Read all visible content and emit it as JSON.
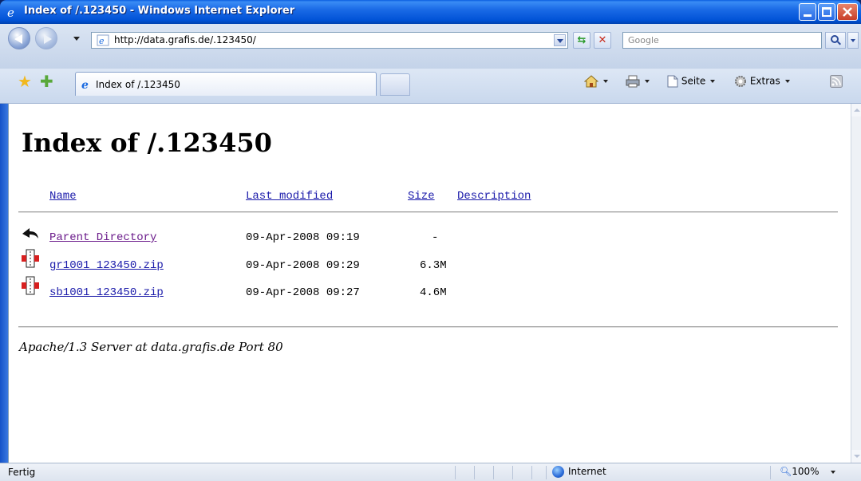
{
  "window": {
    "title": "Index of /.123450 - Windows Internet Explorer"
  },
  "addressbar": {
    "url": "http://data.grafis.de/.123450/",
    "search_placeholder": "Google"
  },
  "tabs": [
    {
      "label": "Index of /.123450"
    }
  ],
  "commandbar": {
    "page_label": "Seite",
    "tools_label": "Extras"
  },
  "page": {
    "title": "Index of /.123450",
    "columns": {
      "name": "Name",
      "modified": "Last modified",
      "size": "Size",
      "description": "Description"
    },
    "rows": [
      {
        "icon": "parent-directory-icon",
        "name": "Parent Directory",
        "modified": "09-Apr-2008 09:19",
        "size": "-",
        "description": ""
      },
      {
        "icon": "zip-file-icon",
        "name": "gr1001_123450.zip",
        "modified": "09-Apr-2008 09:29",
        "size": "6.3M",
        "description": ""
      },
      {
        "icon": "zip-file-icon",
        "name": "sb1001_123450.zip",
        "modified": "09-Apr-2008 09:27",
        "size": "4.6M",
        "description": ""
      }
    ],
    "footer": "Apache/1.3 Server at data.grafis.de Port 80"
  },
  "statusbar": {
    "status": "Fertig",
    "zone": "Internet",
    "zoom": "100%"
  }
}
